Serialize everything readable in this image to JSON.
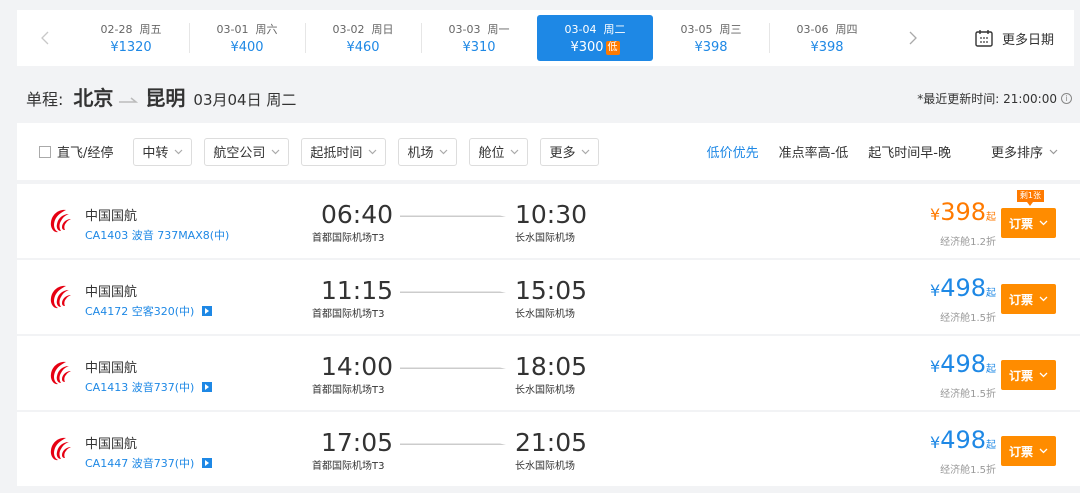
{
  "dates": {
    "prev_icon": "chevron-left-icon",
    "next_icon": "chevron-right-icon",
    "items": [
      {
        "date": "02-28",
        "weekday": "周五",
        "price": "¥1320",
        "active": false
      },
      {
        "date": "03-01",
        "weekday": "周六",
        "price": "¥400",
        "active": false
      },
      {
        "date": "03-02",
        "weekday": "周日",
        "price": "¥460",
        "active": false
      },
      {
        "date": "03-03",
        "weekday": "周一",
        "price": "¥310",
        "active": false
      },
      {
        "date": "03-04",
        "weekday": "周二",
        "price": "¥300",
        "tag": "低",
        "active": true
      },
      {
        "date": "03-05",
        "weekday": "周三",
        "price": "¥398",
        "active": false
      },
      {
        "date": "03-06",
        "weekday": "周四",
        "price": "¥398",
        "active": false
      }
    ],
    "more_label": "更多日期",
    "more_icon": "calendar-icon"
  },
  "route": {
    "label": "单程:",
    "from": "北京",
    "to": "昆明",
    "date": "03月04日 周二",
    "update_text": "*最近更新时间: 21:00:00",
    "info_icon": "i"
  },
  "filters": {
    "direct_label": "直飞/经停",
    "buttons": [
      "中转",
      "航空公司",
      "起抵时间",
      "机场",
      "舱位",
      "更多"
    ],
    "sorts": {
      "low_price": "低价优先",
      "on_time": "准点率高-低",
      "departure": "起飞时间早-晚",
      "more": "更多排序"
    }
  },
  "colors": {
    "accent": "#1e88e5",
    "orange": "#ff7a00",
    "airline_red": "#e60012"
  },
  "flights": [
    {
      "airline": "中国国航",
      "flight_no": "CA1403 波音 737MAX8(中)",
      "share": false,
      "dep_time": "06:40",
      "dep_airport": "首都国际机场T3",
      "arr_time": "10:30",
      "arr_airport": "长水国际机场",
      "currency": "¥",
      "price": "398",
      "qi": "起",
      "price_color": "orange",
      "cabin": "经济舱1.2折",
      "book": "订票",
      "remain": "剩1张"
    },
    {
      "airline": "中国国航",
      "flight_no": "CA4172 空客320(中)",
      "share": true,
      "dep_time": "11:15",
      "dep_airport": "首都国际机场T3",
      "arr_time": "15:05",
      "arr_airport": "长水国际机场",
      "currency": "¥",
      "price": "498",
      "qi": "起",
      "price_color": "blue",
      "cabin": "经济舱1.5折",
      "book": "订票"
    },
    {
      "airline": "中国国航",
      "flight_no": "CA1413 波音737(中)",
      "share": true,
      "dep_time": "14:00",
      "dep_airport": "首都国际机场T3",
      "arr_time": "18:05",
      "arr_airport": "长水国际机场",
      "currency": "¥",
      "price": "498",
      "qi": "起",
      "price_color": "blue",
      "cabin": "经济舱1.5折",
      "book": "订票"
    },
    {
      "airline": "中国国航",
      "flight_no": "CA1447 波音737(中)",
      "share": true,
      "dep_time": "17:05",
      "dep_airport": "首都国际机场T3",
      "arr_time": "21:05",
      "arr_airport": "长水国际机场",
      "currency": "¥",
      "price": "498",
      "qi": "起",
      "price_color": "blue",
      "cabin": "经济舱1.5折",
      "book": "订票"
    }
  ]
}
